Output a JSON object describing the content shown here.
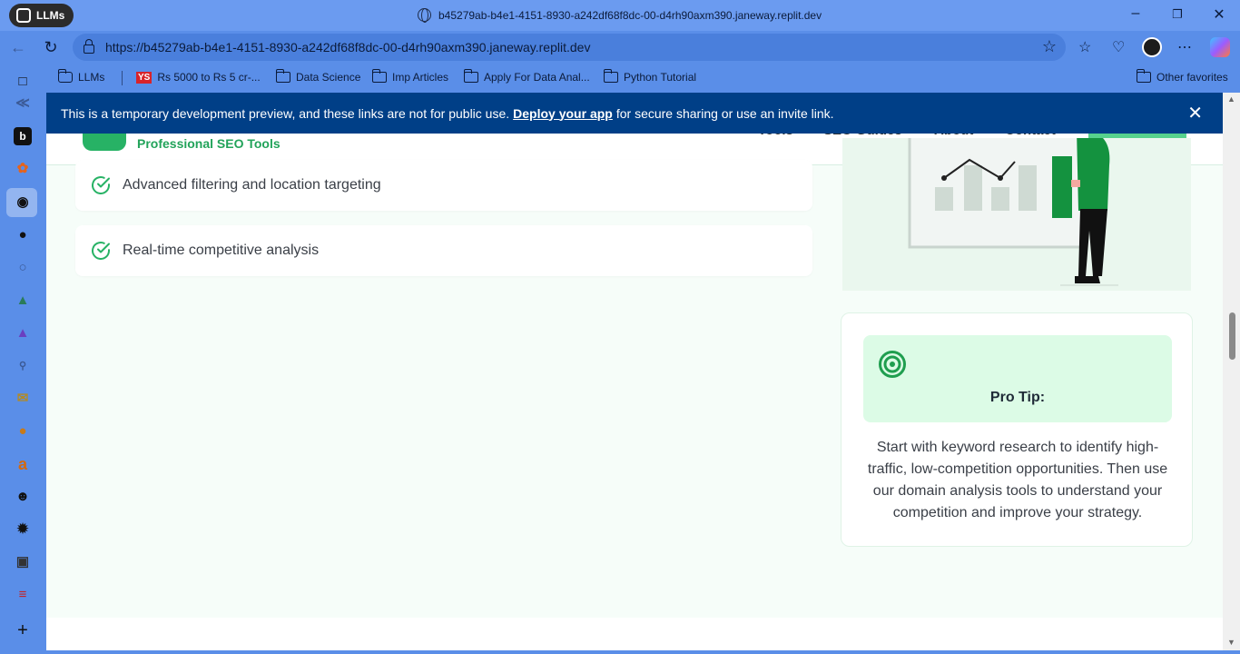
{
  "browser": {
    "profile_label": "LLMs",
    "tab_title": "b45279ab-b4e1-4151-8930-a242df68f8dc-00-d4rh90axm390.janeway.replit.dev",
    "url": "https://b45279ab-b4e1-4151-8930-a242df68f8dc-00-d4rh90axm390.janeway.replit.dev",
    "favorites": [
      {
        "label": "LLMs",
        "icon": "cube-icon"
      },
      {
        "label": "Rs 5000 to Rs 5 cr-...",
        "icon": "ys-logo"
      },
      {
        "label": "Data Science",
        "icon": "folder-icon"
      },
      {
        "label": "Imp Articles",
        "icon": "folder-icon"
      },
      {
        "label": "Apply For Data Anal...",
        "icon": "folder-icon"
      },
      {
        "label": "Python Tutorial",
        "icon": "folder-icon"
      }
    ],
    "other_favorites": "Other favorites",
    "accent_color": "#5a8ee8"
  },
  "dev_banner": {
    "text_before": "This is a temporary development preview, and these links are not for public use.",
    "link": "Deploy your app",
    "text_after": "for secure sharing or use an invite link.",
    "color": "#003f87"
  },
  "site": {
    "brand_subtitle": "Professional SEO Tools",
    "brand_color": "#22a35a",
    "nav": [
      "Tools",
      "SEO Guides",
      "About",
      "Contact"
    ]
  },
  "features": [
    "Advanced filtering and location targeting",
    "Real-time competitive analysis"
  ],
  "pro_tip": {
    "title": "Pro Tip:",
    "body": "Start with keyword research to identify high-traffic, low-competition opportunities. Then use our domain analysis tools to understand your competition and improve your strategy."
  }
}
